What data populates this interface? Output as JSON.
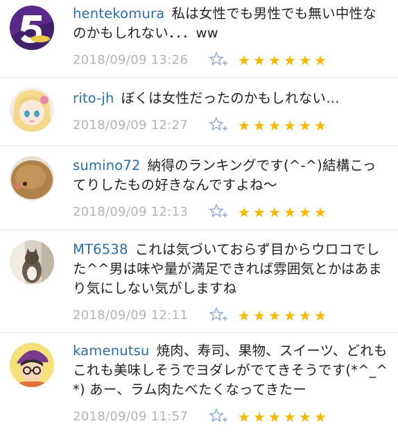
{
  "comments": [
    {
      "user": "hentekomura",
      "text": "私は女性でも男性でも無い中性なのかもしれない．．．ww",
      "time": "2018/09/09 13:26",
      "stars": 6
    },
    {
      "user": "rito-jh",
      "text": "ぼくは女性だったのかもしれない…",
      "time": "2018/09/09 12:27",
      "stars": 6
    },
    {
      "user": "sumino72",
      "text": "納得のランキングです(^-^)結構こってりしたもの好きなんですよね～",
      "time": "2018/09/09 12:13",
      "stars": 6
    },
    {
      "user": "MT6538",
      "text": "これは気づいておらず目からウロコでした^^男は味や量が満足できれば雰囲気とかはあまり気にしない気がしますね",
      "time": "2018/09/09 12:11",
      "stars": 6
    },
    {
      "user": "kamenutsu",
      "text": "焼肉、寿司、果物、スイーツ、どれもこれも美味しそうでヨダレがでてきそうです(*^_^*) あー、ラム肉たべたくなってきたー",
      "time": "2018/09/09 11:57",
      "stars": 6
    }
  ],
  "colors": {
    "username": "#2b6ca8",
    "timestamp": "#b3b3b3",
    "star": "#f5b800",
    "add-star-outline": "#8aa8d6"
  },
  "icons": {
    "add-star": "add-star-icon",
    "star": "star-icon"
  }
}
